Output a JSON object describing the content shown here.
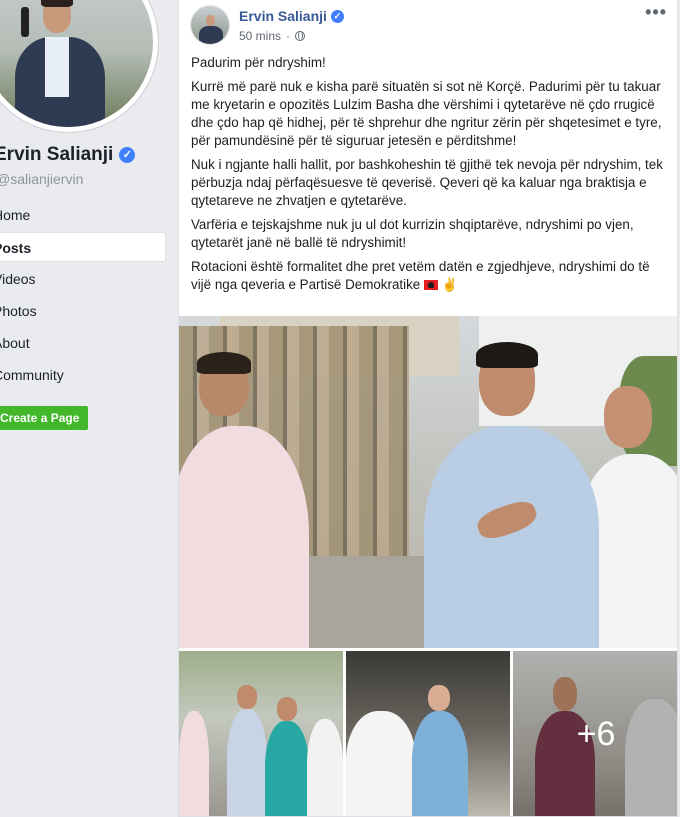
{
  "sidebar": {
    "page_name": "Ervin Salianji",
    "handle": "@salianjiervin",
    "nav": [
      {
        "label": "Home"
      },
      {
        "label": "Posts"
      },
      {
        "label": "Videos"
      },
      {
        "label": "Photos"
      },
      {
        "label": "About"
      },
      {
        "label": "Community"
      }
    ],
    "active_index": 1,
    "create_page_label": "Create a Page"
  },
  "post": {
    "author": "Ervin Salianji",
    "time": "50 mins",
    "separator": "·",
    "more_label": "•••",
    "paragraphs": [
      "Padurim për ndryshim!",
      "Kurrë më parë nuk e kisha parë situatën si sot në Korçë. Padurimi për tu takuar me kryetarin e opozitës Lulzim Basha dhe vërshimi i qytetarëve në çdo rrugicë dhe çdo hap që hidhej, për të shprehur dhe ngritur zërin për shqetesimet e tyre, për pamundësinë për të siguruar jetesën e përditshme!",
      "Nuk i ngjante halli hallit, por bashkoheshin të gjithë tek nevoja për ndryshim, tek përbuzja ndaj përfaqësuesve të qeverisë. Qeveri që ka kaluar nga braktisja e qytetareve ne zhvatjen e qytetarëve.",
      "Varfëria e tejskajshme nuk ju ul dot kurrizin shqiptarëve, ndryshimi po vjen, qytetarët janë në ballë të ndryshimit!"
    ],
    "last_paragraph": "Rotacioni është formalitet dhe pret vetëm datën e zgjedhjeve, ndryshimi do të vijë nga qeveria e Partisë Demokratike",
    "more_photos": "+6"
  },
  "colors": {
    "background": "#e9ebee",
    "link_blue": "#385898",
    "verified_blue": "#4080ff",
    "create_green": "#42b72a"
  },
  "icons": [
    "verified-badge-icon",
    "globe-icon",
    "more-options-icon",
    "albania-flag-icon",
    "victory-hand-icon"
  ]
}
